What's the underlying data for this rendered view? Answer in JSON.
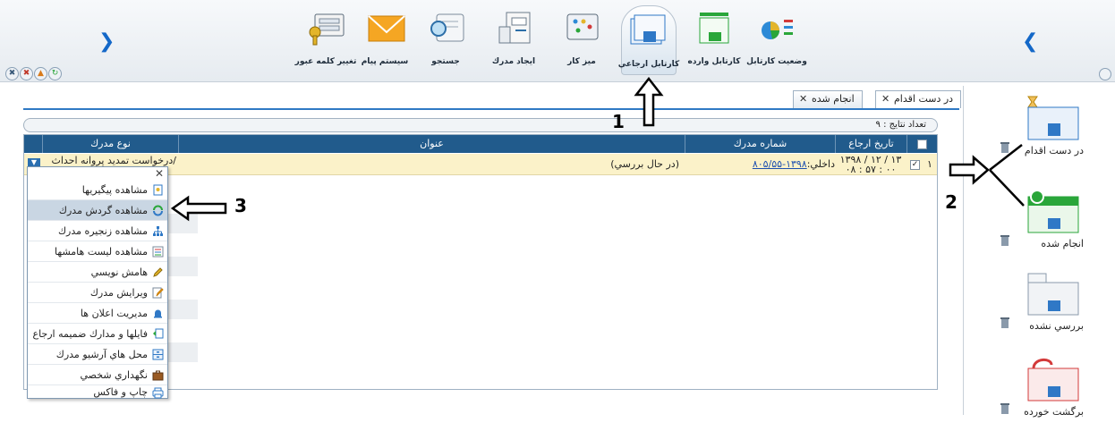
{
  "toolbar": {
    "items": [
      {
        "id": "cartable-status",
        "label": "وضعيت کارتابل"
      },
      {
        "id": "incoming-cartable",
        "label": "کارتابل وارده"
      },
      {
        "id": "referral-cartable",
        "label": "کارتابل ارجاعي"
      },
      {
        "id": "desk",
        "label": "ميز کار"
      },
      {
        "id": "create-document",
        "label": "ايجاد مدرك"
      },
      {
        "id": "search",
        "label": "جستجو"
      },
      {
        "id": "messaging",
        "label": "سيستم پيام"
      },
      {
        "id": "change-password",
        "label": "تغيير کلمه عبور"
      }
    ],
    "active": "کارتابل ارجاعي"
  },
  "cartables": [
    {
      "label": "در دست اقدام",
      "color": "#2f78c6"
    },
    {
      "label": "انجام شده",
      "color": "#2aa63a"
    },
    {
      "label": "بررسي نشده",
      "color": "#8a9aab"
    },
    {
      "label": "برگشت خورده",
      "color": "#d33a3a"
    }
  ],
  "tabs": [
    {
      "label": "در دست اقدام",
      "active": true
    },
    {
      "label": "انجام شده",
      "active": false
    }
  ],
  "results": {
    "count_label": "تعداد نتايج : ۹"
  },
  "grid": {
    "headers": {
      "referral_date": "تاريخ ارجاع",
      "doc_number": "شماره مدرك",
      "title": "عنوان",
      "doc_type": "نوع مدرك"
    },
    "rows": [
      {
        "index": "۱",
        "date_line1": "۱۳۹۸ / ۱۲ / ۱۳",
        "date_line2": "۰۸ : ۵۷ : ۰۰",
        "doc_number_prefix": "داخلي:",
        "doc_number": "۱۳۹۸-۸۰۵/۵۵",
        "title": "(در حال بررسي)",
        "doc_type": "درخواست تمديد پروانه احداث/"
      }
    ]
  },
  "context_menu": {
    "items": [
      {
        "label": "مشاهده پيگيريها",
        "icon": "follow-up-icon"
      },
      {
        "label": "مشاهده گردش مدرك",
        "icon": "document-flow-icon",
        "selected": true
      },
      {
        "label": "مشاهده زنجيره مدرك",
        "icon": "document-chain-icon"
      },
      {
        "label": "مشاهده ليست هامشها",
        "icon": "annotation-list-icon"
      },
      {
        "label": "هامش نويسي",
        "icon": "pencil-icon"
      },
      {
        "label": "ويرايش مدرك",
        "icon": "edit-icon"
      },
      {
        "label": "مديريت اعلان ها",
        "icon": "bell-icon"
      },
      {
        "label": "فايلها و مدارك ضميمه ارجاع",
        "icon": "attachment-icon"
      },
      {
        "label": "محل هاي آرشيو مدرك",
        "icon": "archive-icon"
      },
      {
        "label": "نگهداري شخصي",
        "icon": "briefcase-icon"
      },
      {
        "label": "چاپ و فاكس",
        "icon": "printer-icon"
      }
    ]
  },
  "annotations": [
    "1",
    "2",
    "3"
  ],
  "colors": {
    "header": "#215b8c",
    "row_highlight": "#fbf2c9",
    "accent": "#1468c8",
    "selected_menu": "#c9d6e3"
  }
}
